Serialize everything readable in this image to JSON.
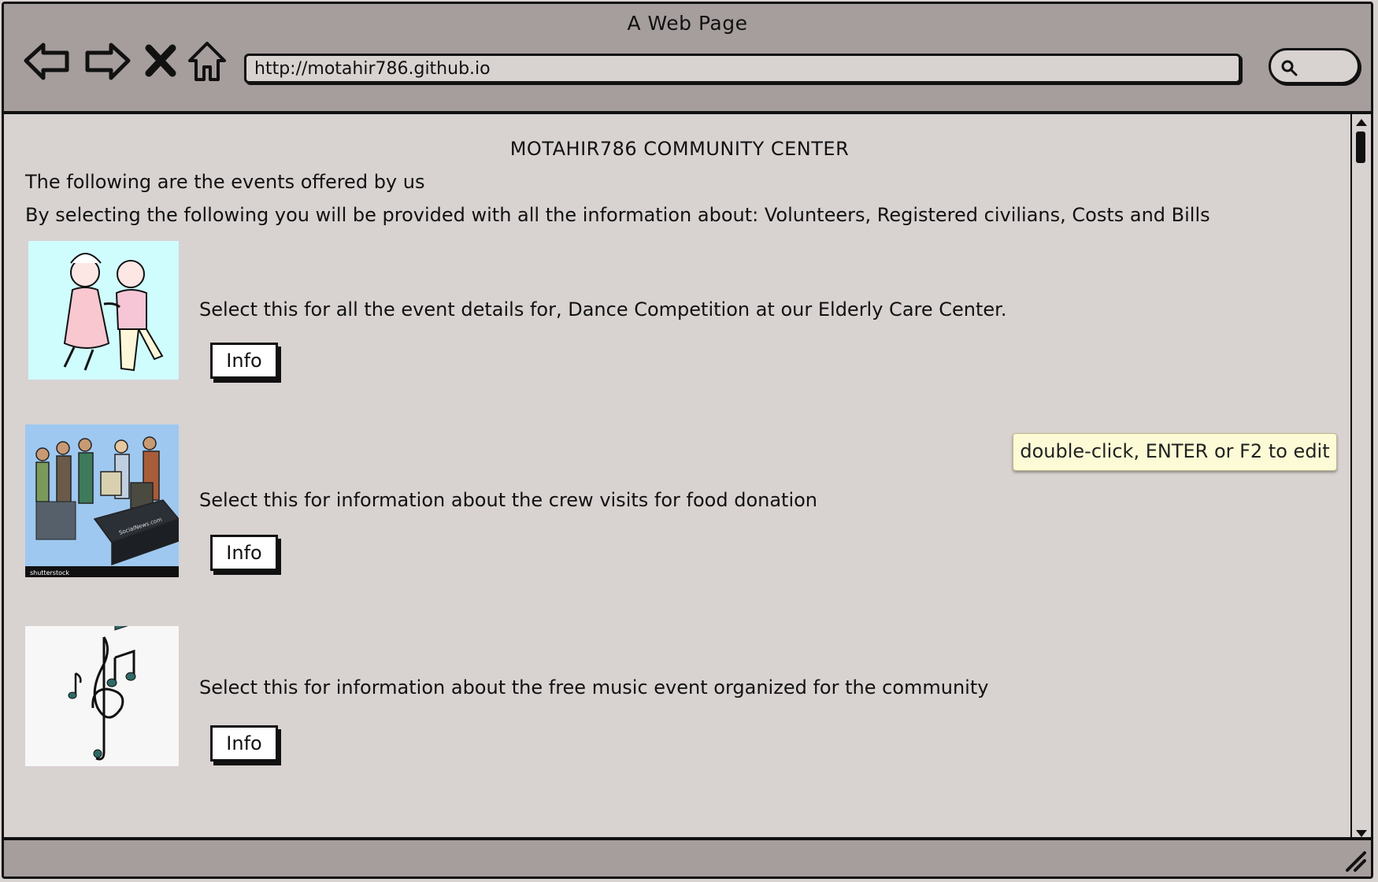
{
  "window": {
    "title": "A Web Page",
    "address": "http://motahir786.github.io"
  },
  "toolbar": {
    "back_icon": "back-arrow-icon",
    "forward_icon": "forward-arrow-icon",
    "stop_icon": "close-icon",
    "home_icon": "home-icon",
    "search_icon": "search-icon"
  },
  "page": {
    "heading": "MOTAHIR786 COMMUNITY CENTER",
    "intro_line1": "The following are the events offered by us",
    "intro_line2": "By selecting the following you will be provided with all the information about: Volunteers, Registered civilians, Costs and Bills"
  },
  "events": [
    {
      "image_icon": "elderly-dancing-couple-image",
      "text": "Select this for all the event details for, Dance Competition at our Elderly Care Center.",
      "button_label": "Info"
    },
    {
      "image_icon": "food-donation-crowd-image",
      "text": "Select this for information about the crew visits for food donation",
      "button_label": "Info"
    },
    {
      "image_icon": "music-notes-image",
      "text": "Select this for information about the free music event organized for the community",
      "button_label": "Info"
    }
  ],
  "tooltip": {
    "text": "double-click, ENTER or F2 to edit"
  }
}
